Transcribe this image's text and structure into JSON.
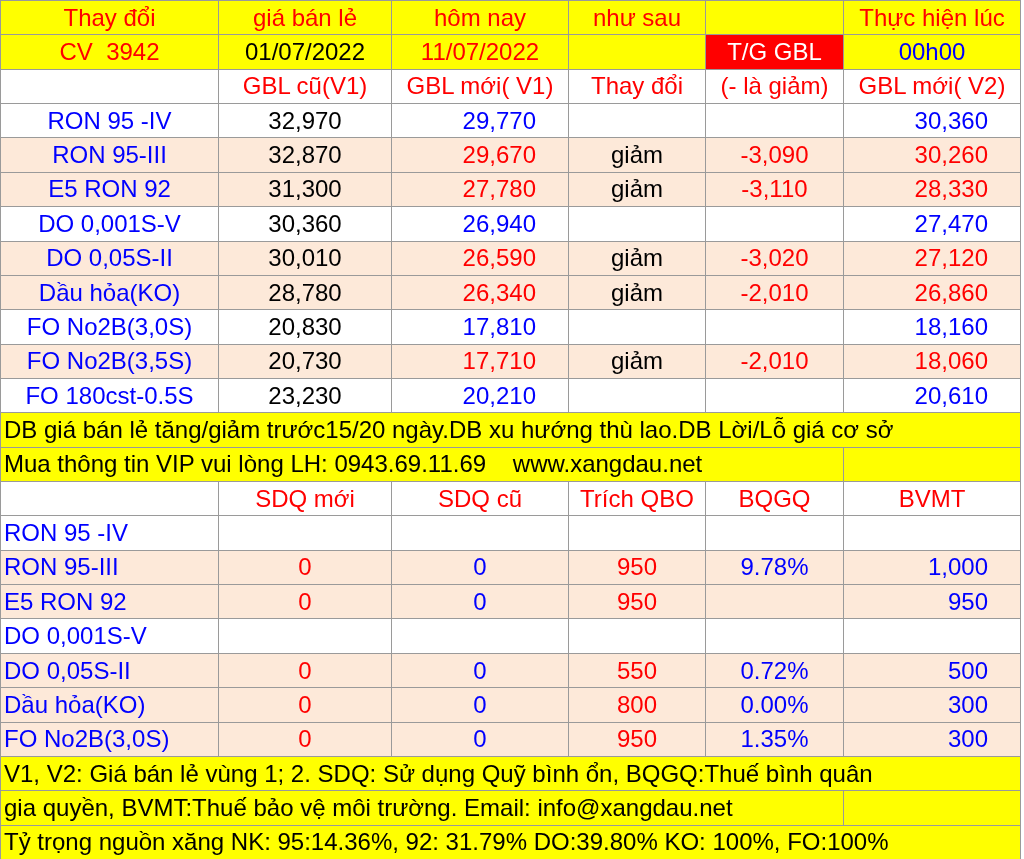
{
  "sheet": {
    "rows": [
      {
        "kind": "header",
        "color": "#ffff00",
        "cells": [
          {
            "text": "Thay đổi",
            "color": "#ff0000"
          },
          {
            "text": "giá bán lẻ",
            "color": "#ff0000"
          },
          {
            "text": "hôm nay",
            "color": "#ff0000"
          },
          {
            "text": "như sau",
            "color": "#ff0000"
          },
          {},
          {
            "text": "Thực hiện lúc",
            "color": "#ff0000"
          }
        ]
      },
      {
        "kind": "header",
        "color": "#ffff00",
        "cells": [
          {
            "text": "CV  3942",
            "color": "#ff0000"
          },
          {
            "text": "01/07/2022",
            "color": "#000000"
          },
          {
            "text": "11/07/2022",
            "color": "#ff0000"
          },
          {},
          {
            "text": "T/G GBL",
            "color": "#ffffff",
            "highlight": true
          },
          {
            "text": "00h00",
            "color": "#0000ff"
          }
        ]
      },
      {
        "kind": "header",
        "color": "#ffffff",
        "cells": [
          {},
          {
            "text": "GBL cũ(V1)",
            "color": "#ff0000"
          },
          {
            "text": "GBL mới( V1)",
            "color": "#ff0000"
          },
          {
            "text": "Thay đổi",
            "color": "#ff0000"
          },
          {
            "text": "(- là giảm)",
            "color": "#ff0000"
          },
          {
            "text": "GBL mới( V2)",
            "color": "#ff0000"
          }
        ]
      },
      {
        "kind": "price",
        "color": "#ffffff",
        "cells": [
          {
            "text": "RON 95 -IV",
            "color": "#0000ff"
          },
          {
            "text": "32,970",
            "color": "#000000"
          },
          {
            "text": "29,770",
            "color": "#0000ff"
          },
          {},
          {},
          {
            "text": "30,360",
            "color": "#0000ff"
          }
        ]
      },
      {
        "kind": "price",
        "color": "#fde9d9",
        "cells": [
          {
            "text": "RON 95-III",
            "color": "#0000ff"
          },
          {
            "text": "32,870",
            "color": "#000000"
          },
          {
            "text": "29,670",
            "color": "#ff0000"
          },
          {
            "text": "giảm",
            "color": "#000000"
          },
          {
            "text": "-3,090",
            "color": "#ff0000"
          },
          {
            "text": "30,260",
            "color": "#ff0000"
          }
        ]
      },
      {
        "kind": "price",
        "color": "#fde9d9",
        "cells": [
          {
            "text": "E5 RON 92",
            "color": "#0000ff"
          },
          {
            "text": "31,300",
            "color": "#000000"
          },
          {
            "text": "27,780",
            "color": "#ff0000"
          },
          {
            "text": "giảm",
            "color": "#000000"
          },
          {
            "text": "-3,110",
            "color": "#ff0000"
          },
          {
            "text": "28,330",
            "color": "#ff0000"
          }
        ]
      },
      {
        "kind": "price",
        "color": "#ffffff",
        "cells": [
          {
            "text": "DO 0,001S-V",
            "color": "#0000ff"
          },
          {
            "text": "30,360",
            "color": "#000000"
          },
          {
            "text": "26,940",
            "color": "#0000ff"
          },
          {},
          {},
          {
            "text": "27,470",
            "color": "#0000ff"
          }
        ]
      },
      {
        "kind": "price",
        "color": "#fde9d9",
        "cells": [
          {
            "text": "DO 0,05S-II",
            "color": "#0000ff"
          },
          {
            "text": "30,010",
            "color": "#000000"
          },
          {
            "text": "26,590",
            "color": "#ff0000"
          },
          {
            "text": "giảm",
            "color": "#000000"
          },
          {
            "text": "-3,020",
            "color": "#ff0000"
          },
          {
            "text": "27,120",
            "color": "#ff0000"
          }
        ]
      },
      {
        "kind": "price",
        "color": "#fde9d9",
        "cells": [
          {
            "text": "Dầu hỏa(KO)",
            "color": "#0000ff"
          },
          {
            "text": "28,780",
            "color": "#000000"
          },
          {
            "text": "26,340",
            "color": "#ff0000"
          },
          {
            "text": "giảm",
            "color": "#000000"
          },
          {
            "text": "-2,010",
            "color": "#ff0000"
          },
          {
            "text": "26,860",
            "color": "#ff0000"
          }
        ]
      },
      {
        "kind": "price",
        "color": "#ffffff",
        "cells": [
          {
            "text": "FO No2B(3,0S)",
            "color": "#0000ff"
          },
          {
            "text": "20,830",
            "color": "#000000"
          },
          {
            "text": "17,810",
            "color": "#0000ff"
          },
          {},
          {},
          {
            "text": "18,160",
            "color": "#0000ff"
          }
        ]
      },
      {
        "kind": "price",
        "color": "#fde9d9",
        "cells": [
          {
            "text": "FO No2B(3,5S)",
            "color": "#0000ff"
          },
          {
            "text": "20,730",
            "color": "#000000"
          },
          {
            "text": "17,710",
            "color": "#ff0000"
          },
          {
            "text": "giảm",
            "color": "#000000"
          },
          {
            "text": "-2,010",
            "color": "#ff0000"
          },
          {
            "text": "18,060",
            "color": "#ff0000"
          }
        ]
      },
      {
        "kind": "price",
        "color": "#ffffff",
        "cells": [
          {
            "text": "FO 180cst-0.5S",
            "color": "#0000ff"
          },
          {
            "text": "23,230",
            "color": "#000000"
          },
          {
            "text": "20,210",
            "color": "#0000ff"
          },
          {},
          {},
          {
            "text": "20,610",
            "color": "#0000ff"
          }
        ]
      },
      {
        "kind": "note",
        "color": "#ffff00",
        "cells": [
          {
            "text": "DB giá bán lẻ tăng/giảm trước15/20 ngày.DB xu hướng thù lao.DB Lời/Lỗ giá cơ sở",
            "color": "#000000"
          }
        ]
      },
      {
        "kind": "note",
        "color": "#ffff00",
        "cells": [
          {
            "text": "Mua thông tin VIP vui lòng LH: 0943.69.11.69    www.xangdau.net",
            "color": "#000000"
          },
          {}
        ]
      },
      {
        "kind": "header",
        "color": "#ffffff",
        "cells": [
          {},
          {
            "text": "SDQ mới",
            "color": "#ff0000"
          },
          {
            "text": "SDQ cũ",
            "color": "#ff0000"
          },
          {
            "text": "Trích QBO",
            "color": "#ff0000"
          },
          {
            "text": "BQGQ",
            "color": "#ff0000"
          },
          {
            "text": "BVMT",
            "color": "#ff0000"
          }
        ]
      },
      {
        "kind": "tax",
        "color": "#ffffff",
        "cells": [
          {
            "text": "RON 95 -IV",
            "color": "#0000ff"
          },
          {},
          {},
          {},
          {},
          {}
        ]
      },
      {
        "kind": "tax",
        "color": "#fde9d9",
        "cells": [
          {
            "text": "RON 95-III",
            "color": "#0000ff"
          },
          {
            "text": "0",
            "color": "#ff0000"
          },
          {
            "text": "0",
            "color": "#0000ff"
          },
          {
            "text": "950",
            "color": "#ff0000"
          },
          {
            "text": "9.78%",
            "color": "#0000ff"
          },
          {
            "text": "1,000",
            "color": "#0000ff"
          }
        ]
      },
      {
        "kind": "tax",
        "color": "#fde9d9",
        "cells": [
          {
            "text": "E5 RON 92",
            "color": "#0000ff"
          },
          {
            "text": "0",
            "color": "#ff0000"
          },
          {
            "text": "0",
            "color": "#0000ff"
          },
          {
            "text": "950",
            "color": "#ff0000"
          },
          {},
          {
            "text": "950",
            "color": "#0000ff"
          }
        ]
      },
      {
        "kind": "tax",
        "color": "#ffffff",
        "cells": [
          {
            "text": "DO 0,001S-V",
            "color": "#0000ff"
          },
          {},
          {},
          {},
          {},
          {}
        ]
      },
      {
        "kind": "tax",
        "color": "#fde9d9",
        "cells": [
          {
            "text": "DO 0,05S-II",
            "color": "#0000ff"
          },
          {
            "text": "0",
            "color": "#ff0000"
          },
          {
            "text": "0",
            "color": "#0000ff"
          },
          {
            "text": "550",
            "color": "#ff0000"
          },
          {
            "text": "0.72%",
            "color": "#0000ff"
          },
          {
            "text": "500",
            "color": "#0000ff"
          }
        ]
      },
      {
        "kind": "tax",
        "color": "#fde9d9",
        "cells": [
          {
            "text": "Dầu hỏa(KO)",
            "color": "#0000ff"
          },
          {
            "text": "0",
            "color": "#ff0000"
          },
          {
            "text": "0",
            "color": "#0000ff"
          },
          {
            "text": "800",
            "color": "#ff0000"
          },
          {
            "text": "0.00%",
            "color": "#0000ff"
          },
          {
            "text": "300",
            "color": "#0000ff"
          }
        ]
      },
      {
        "kind": "tax",
        "color": "#fde9d9",
        "cells": [
          {
            "text": "FO No2B(3,0S)",
            "color": "#0000ff"
          },
          {
            "text": "0",
            "color": "#ff0000"
          },
          {
            "text": "0",
            "color": "#0000ff"
          },
          {
            "text": "950",
            "color": "#ff0000"
          },
          {
            "text": "1.35%",
            "color": "#0000ff"
          },
          {
            "text": "300",
            "color": "#0000ff"
          }
        ]
      },
      {
        "kind": "note",
        "color": "#ffff00",
        "cells": [
          {
            "text": "V1, V2: Giá bán lẻ vùng 1; 2. SDQ: Sử dụng Quỹ bình ổn, BQGQ:Thuế bình quân",
            "color": "#000000"
          }
        ]
      },
      {
        "kind": "note",
        "color": "#ffff00",
        "cells": [
          {
            "text": "gia quyền, BVMT:Thuế bảo vệ môi trường. Email: info@xangdau.net",
            "color": "#000000"
          },
          {}
        ]
      },
      {
        "kind": "note",
        "color": "#ffff00",
        "cells": [
          {
            "text": "Tỷ trọng nguồn xăng NK: 95:14.36%, 92: 31.79% DO:39.80% KO: 100%, FO:100%",
            "color": "#000000"
          }
        ]
      }
    ]
  }
}
